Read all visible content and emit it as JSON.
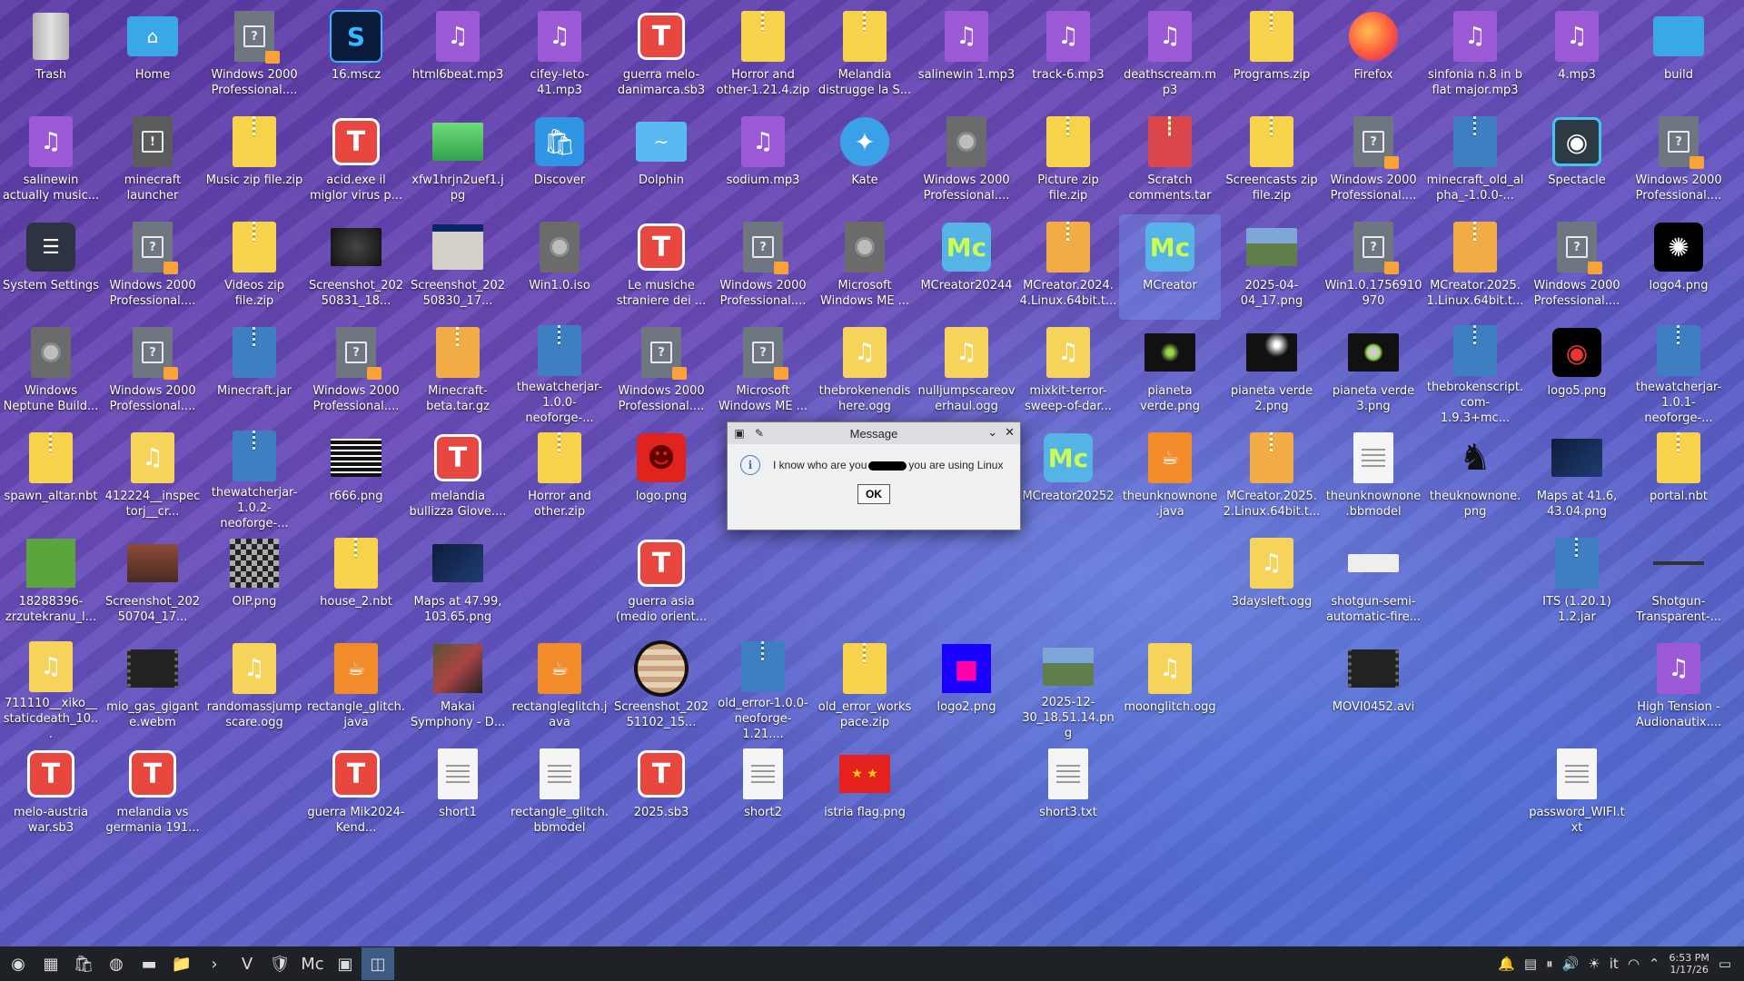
{
  "desktop": {
    "icons": [
      {
        "label": "Trash",
        "glyph": "trash",
        "col": 0,
        "row": 0
      },
      {
        "label": "Home",
        "glyph": "folder-home",
        "col": 1,
        "row": 0
      },
      {
        "label": "Windows 2000 Professional....",
        "glyph": "qdoc",
        "col": 2,
        "row": 0
      },
      {
        "label": "16.mscz",
        "glyph": "musescore",
        "col": 3,
        "row": 0
      },
      {
        "label": "html6beat.mp3",
        "glyph": "music",
        "col": 4,
        "row": 0
      },
      {
        "label": "cifey-leto-41.mp3",
        "glyph": "music",
        "col": 5,
        "row": 0
      },
      {
        "label": "guerra melo-danimarca.sb3",
        "glyph": "scratch",
        "col": 6,
        "row": 0
      },
      {
        "label": "Horror and other-1.21.4.zip",
        "glyph": "zip",
        "col": 7,
        "row": 0
      },
      {
        "label": "Melandia distrugge la S...",
        "glyph": "zip",
        "col": 8,
        "row": 0
      },
      {
        "label": "salinewin 1.mp3",
        "glyph": "music",
        "col": 9,
        "row": 0
      },
      {
        "label": "track-6.mp3",
        "glyph": "music",
        "col": 10,
        "row": 0
      },
      {
        "label": "deathscream.mp3",
        "glyph": "music",
        "col": 11,
        "row": 0
      },
      {
        "label": "Programs.zip",
        "glyph": "zip",
        "col": 12,
        "row": 0
      },
      {
        "label": "Firefox",
        "glyph": "firefox",
        "col": 13,
        "row": 0
      },
      {
        "label": "sinfonia n.8 in b flat major.mp3",
        "glyph": "music",
        "col": 14,
        "row": 0
      },
      {
        "label": "4.mp3",
        "glyph": "music",
        "col": 15,
        "row": 0
      },
      {
        "label": "build",
        "glyph": "folder",
        "col": 16,
        "row": 0
      },
      {
        "label": "salinewin actually music...",
        "glyph": "music",
        "col": 0,
        "row": 1
      },
      {
        "label": "minecraft launcher",
        "glyph": "launcher",
        "col": 1,
        "row": 1
      },
      {
        "label": "Music zip file.zip",
        "glyph": "zip",
        "col": 2,
        "row": 1
      },
      {
        "label": "acid.exe il miglor virus p...",
        "glyph": "scratch",
        "col": 3,
        "row": 1
      },
      {
        "label": "xfw1hrjn2uef1.jpg",
        "glyph": "img-green",
        "col": 4,
        "row": 1
      },
      {
        "label": "Discover",
        "glyph": "discover",
        "col": 5,
        "row": 1
      },
      {
        "label": "Dolphin",
        "glyph": "dolphin",
        "col": 6,
        "row": 1
      },
      {
        "label": "sodium.mp3",
        "glyph": "music",
        "col": 7,
        "row": 1
      },
      {
        "label": "Kate",
        "glyph": "kate",
        "col": 8,
        "row": 1
      },
      {
        "label": "Windows 2000 Professional....",
        "glyph": "disc",
        "col": 9,
        "row": 1
      },
      {
        "label": "Picture zip file.zip",
        "glyph": "zip",
        "col": 10,
        "row": 1
      },
      {
        "label": "Scratch comments.tar",
        "glyph": "zip-red",
        "col": 11,
        "row": 1
      },
      {
        "label": "Screencasts zip file.zip",
        "glyph": "zip",
        "col": 12,
        "row": 1
      },
      {
        "label": "Windows 2000 Professional....",
        "glyph": "qdoc",
        "col": 13,
        "row": 1
      },
      {
        "label": "minecraft_old_alpha_-1.0.0-...",
        "glyph": "zip-blue",
        "col": 14,
        "row": 1
      },
      {
        "label": "Spectacle",
        "glyph": "spectacle",
        "col": 15,
        "row": 1
      },
      {
        "label": "Windows 2000 Professional....",
        "glyph": "qdoc",
        "col": 16,
        "row": 1
      },
      {
        "label": "System Settings",
        "glyph": "settings",
        "col": 0,
        "row": 2
      },
      {
        "label": "Windows 2000 Professional....",
        "glyph": "qdoc",
        "col": 1,
        "row": 2
      },
      {
        "label": "Videos zip file.zip",
        "glyph": "zip",
        "col": 2,
        "row": 2
      },
      {
        "label": "Screenshot_20250831_18...",
        "glyph": "img-dark",
        "col": 3,
        "row": 2
      },
      {
        "label": "Screenshot_20250830_17...",
        "glyph": "img-win",
        "col": 4,
        "row": 2
      },
      {
        "label": "Win1.0.iso",
        "glyph": "disc",
        "col": 5,
        "row": 2
      },
      {
        "label": "Le musiche straniere dei ...",
        "glyph": "scratch",
        "col": 6,
        "row": 2
      },
      {
        "label": "Windows 2000 Professional....",
        "glyph": "qdoc",
        "col": 7,
        "row": 2
      },
      {
        "label": "Microsoft Windows ME ...",
        "glyph": "disc",
        "col": 8,
        "row": 2
      },
      {
        "label": "MCreator20244",
        "glyph": "mcreator",
        "col": 9,
        "row": 2
      },
      {
        "label": "MCreator.2024.4.Linux.64bit.t...",
        "glyph": "zip-orange",
        "col": 10,
        "row": 2
      },
      {
        "label": "MCreator",
        "glyph": "mcreator",
        "col": 11,
        "row": 2,
        "selected": true
      },
      {
        "label": "2025-04-04_17.png",
        "glyph": "img-land",
        "col": 12,
        "row": 2
      },
      {
        "label": "Win1.0.1756910970",
        "glyph": "qdoc",
        "col": 13,
        "row": 2
      },
      {
        "label": "MCreator.2025.1.Linux.64bit.t...",
        "glyph": "zip-orange",
        "col": 14,
        "row": 2
      },
      {
        "label": "Windows 2000 Professional....",
        "glyph": "qdoc",
        "col": 15,
        "row": 2
      },
      {
        "label": "logo4.png",
        "glyph": "img-logo4",
        "col": 16,
        "row": 2
      },
      {
        "label": "Windows Neptune Build...",
        "glyph": "disc",
        "col": 0,
        "row": 3
      },
      {
        "label": "Windows 2000 Professional....",
        "glyph": "qdoc",
        "col": 1,
        "row": 3
      },
      {
        "label": "Minecraft.jar",
        "glyph": "zip-blue",
        "col": 2,
        "row": 3
      },
      {
        "label": "Windows 2000 Professional....",
        "glyph": "qdoc",
        "col": 3,
        "row": 3
      },
      {
        "label": "Minecraft-beta.tar.gz",
        "glyph": "zip-orange",
        "col": 4,
        "row": 3
      },
      {
        "label": "thewatcherjar-1.0.0-neoforge-...",
        "glyph": "zip-blue",
        "col": 5,
        "row": 3
      },
      {
        "label": "Windows 2000 Professional....",
        "glyph": "qdoc",
        "col": 6,
        "row": 3
      },
      {
        "label": "Microsoft Windows ME ...",
        "glyph": "qdoc",
        "col": 7,
        "row": 3
      },
      {
        "label": "thebrokenendis here.ogg",
        "glyph": "music-yellow",
        "col": 8,
        "row": 3
      },
      {
        "label": "nulljumpscareoverhaul.ogg",
        "glyph": "music-yellow",
        "col": 9,
        "row": 3
      },
      {
        "label": "mixkit-terror-sweep-of-dar...",
        "glyph": "music-yellow",
        "col": 10,
        "row": 3
      },
      {
        "label": "pianeta verde.png",
        "glyph": "img-planet",
        "col": 11,
        "row": 3
      },
      {
        "label": "pianeta verde 2.png",
        "glyph": "img-planet2",
        "col": 12,
        "row": 3
      },
      {
        "label": "pianeta verde 3.png",
        "glyph": "img-planet3",
        "col": 13,
        "row": 3
      },
      {
        "label": "thebrokenscript.com-1.9.3+mc...",
        "glyph": "zip-blue",
        "col": 14,
        "row": 3
      },
      {
        "label": "logo5.png",
        "glyph": "img-eye",
        "col": 15,
        "row": 3
      },
      {
        "label": "thewatcherjar-1.0.1-neoforge-...",
        "glyph": "zip-blue",
        "col": 16,
        "row": 3
      },
      {
        "label": "spawn_altar.nbt",
        "glyph": "zip",
        "col": 0,
        "row": 4
      },
      {
        "label": "412224__inspectorj__cr...",
        "glyph": "music-yellow",
        "col": 1,
        "row": 4
      },
      {
        "label": "thewatcherjar-1.0.2-neoforge-...",
        "glyph": "zip-blue",
        "col": 2,
        "row": 4
      },
      {
        "label": "r666.png",
        "glyph": "img-text",
        "col": 3,
        "row": 4
      },
      {
        "label": "melandia bullizza Giove....",
        "glyph": "scratch",
        "col": 4,
        "row": 4
      },
      {
        "label": "Horror and other.zip",
        "glyph": "zip",
        "col": 5,
        "row": 4
      },
      {
        "label": "logo.png",
        "glyph": "img-redface",
        "col": 6,
        "row": 4
      },
      {
        "label": "MCreator20252",
        "glyph": "mcreator",
        "col": 10,
        "row": 4
      },
      {
        "label": "theunknownone.java",
        "glyph": "java",
        "col": 11,
        "row": 4
      },
      {
        "label": "MCreator.2025.2.Linux.64bit.t...",
        "glyph": "zip-orange",
        "col": 12,
        "row": 4
      },
      {
        "label": "theunknownone.bbmodel",
        "glyph": "doc",
        "col": 13,
        "row": 4
      },
      {
        "label": "theuknownone.png",
        "glyph": "img-pixel",
        "col": 14,
        "row": 4
      },
      {
        "label": "Maps at 41.6, 43.04.png",
        "glyph": "img-map",
        "col": 15,
        "row": 4
      },
      {
        "label": "portal.nbt",
        "glyph": "zip",
        "col": 16,
        "row": 4
      },
      {
        "label": "18288396-zrzutekranu_l...",
        "glyph": "img-grass",
        "col": 0,
        "row": 5
      },
      {
        "label": "Screenshot_20250704_17...",
        "glyph": "img-brown",
        "col": 1,
        "row": 5
      },
      {
        "label": "OIP.png",
        "glyph": "img-noise",
        "col": 2,
        "row": 5
      },
      {
        "label": "house_2.nbt",
        "glyph": "zip",
        "col": 3,
        "row": 5
      },
      {
        "label": "Maps at 47.99, 103.65.png",
        "glyph": "img-map",
        "col": 4,
        "row": 5
      },
      {
        "label": "guerra asia (medio orient...",
        "glyph": "scratch",
        "col": 6,
        "row": 5
      },
      {
        "label": "3daysleft.ogg",
        "glyph": "music-yellow",
        "col": 12,
        "row": 5
      },
      {
        "label": "shotgun-semi-automatic-fire...",
        "glyph": "img-white",
        "col": 13,
        "row": 5
      },
      {
        "label": "ITS (1.20.1) 1.2.jar",
        "glyph": "zip-blue",
        "col": 15,
        "row": 5
      },
      {
        "label": "Shotgun-Transparent-...",
        "glyph": "img-gun",
        "col": 16,
        "row": 5
      },
      {
        "label": "711110__xiko__staticdeath_10...",
        "glyph": "music-yellow",
        "col": 0,
        "row": 6
      },
      {
        "label": "mio_gas_gigante.webm",
        "glyph": "img-video",
        "col": 1,
        "row": 6
      },
      {
        "label": "randomassjumpscare.ogg",
        "glyph": "music-yellow",
        "col": 2,
        "row": 6
      },
      {
        "label": "rectangle_glitch.java",
        "glyph": "java",
        "col": 3,
        "row": 6
      },
      {
        "label": "Makai Symphony - D...",
        "glyph": "img-art",
        "col": 4,
        "row": 6
      },
      {
        "label": "rectangleglitch.java",
        "glyph": "java",
        "col": 5,
        "row": 6
      },
      {
        "label": "Screenshot_20251102_15...",
        "glyph": "img-jupiter",
        "col": 6,
        "row": 6
      },
      {
        "label": "old_error-1.0.0-neoforge-1.21....",
        "glyph": "zip-blue",
        "col": 7,
        "row": 6
      },
      {
        "label": "old_error_workspace.zip",
        "glyph": "zip",
        "col": 8,
        "row": 6
      },
      {
        "label": "logo2.png",
        "glyph": "img-logo2",
        "col": 9,
        "row": 6
      },
      {
        "label": "2025-12-30_18.51.14.png",
        "glyph": "img-land",
        "col": 10,
        "row": 6
      },
      {
        "label": "moonglitch.ogg",
        "glyph": "music-yellow",
        "col": 11,
        "row": 6
      },
      {
        "label": "MOVI0452.avi",
        "glyph": "img-video",
        "col": 13,
        "row": 6
      },
      {
        "label": "High Tension - Audionautix....",
        "glyph": "music",
        "col": 16,
        "row": 6
      },
      {
        "label": "melo-austria war.sb3",
        "glyph": "scratch",
        "col": 0,
        "row": 7
      },
      {
        "label": "melandia vs germania 191...",
        "glyph": "scratch",
        "col": 1,
        "row": 7
      },
      {
        "label": "guerra Mik2024-Kend...",
        "glyph": "scratch",
        "col": 3,
        "row": 7
      },
      {
        "label": "short1",
        "glyph": "doc",
        "col": 4,
        "row": 7
      },
      {
        "label": "rectangle_glitch.bbmodel",
        "glyph": "doc",
        "col": 5,
        "row": 7
      },
      {
        "label": "2025.sb3",
        "glyph": "scratch",
        "col": 6,
        "row": 7
      },
      {
        "label": "short2",
        "glyph": "doc",
        "col": 7,
        "row": 7
      },
      {
        "label": "istria flag.png",
        "glyph": "img-flag",
        "col": 8,
        "row": 7
      },
      {
        "label": "short3.txt",
        "glyph": "doc",
        "col": 10,
        "row": 7
      },
      {
        "label": "password_WIFI.txt",
        "glyph": "doc",
        "col": 15,
        "row": 7
      }
    ]
  },
  "dialog": {
    "title": "Message",
    "text_before": "I know who are you",
    "text_after": "you are using Linux",
    "ok_label": "OK"
  },
  "taskbar": {
    "apps": [
      "app-launcher-icon",
      "desktop-icon",
      "discover-icon",
      "firefox-icon",
      "konsole-icon",
      "dolphin-icon",
      "terminal-icon",
      "vim-icon",
      "brave-icon",
      "mcreator-icon",
      "minecraft-icon",
      "message-window-icon"
    ],
    "active_index": 11,
    "tray_lang": "it",
    "time": "6:53 PM",
    "date": "1/17/26"
  }
}
